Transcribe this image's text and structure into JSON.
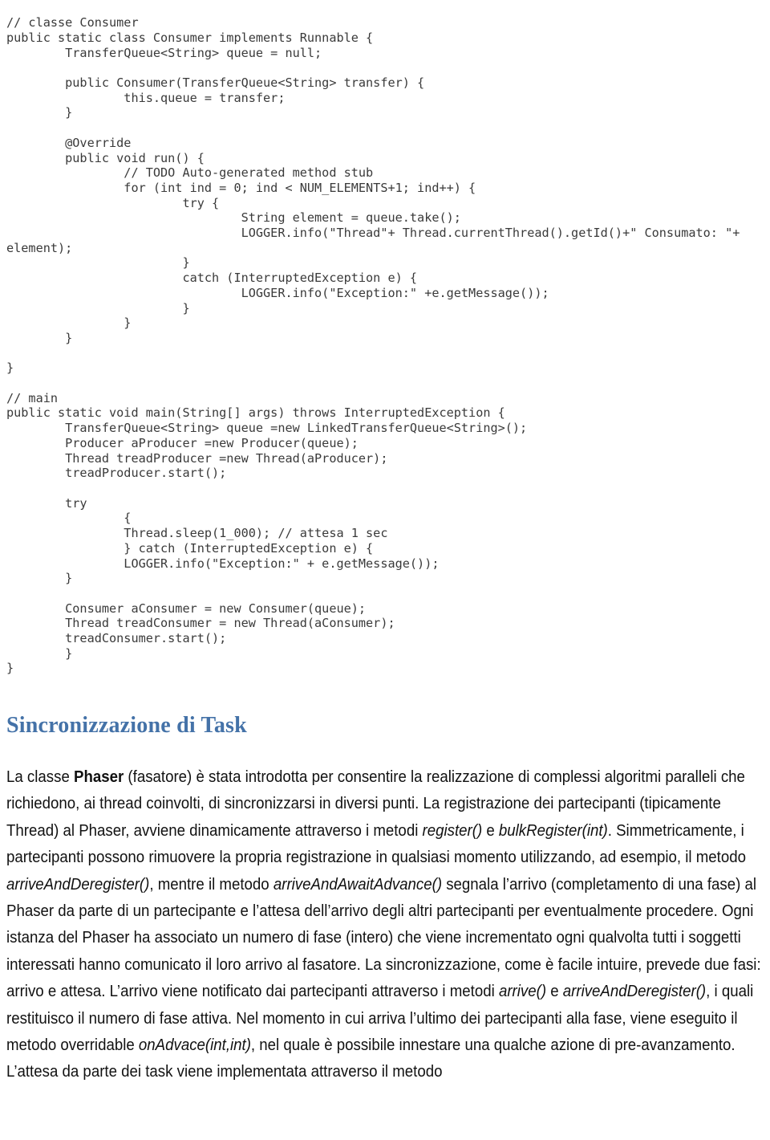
{
  "document": {
    "code_listing": {
      "language": "java",
      "lines": [
        "// classe Consumer",
        "public static class Consumer implements Runnable {",
        "        TransferQueue<String> queue = null;",
        "",
        "        public Consumer(TransferQueue<String> transfer) {",
        "                this.queue = transfer;",
        "        }",
        "",
        "        @Override",
        "        public void run() {",
        "                // TODO Auto-generated method stub",
        "                for (int ind = 0; ind < NUM_ELEMENTS+1; ind++) {",
        "                        try {",
        "                                String element = queue.take();",
        "                                LOGGER.info(\"Thread\"+ Thread.currentThread().getId()+\" Consumato: \"+",
        "element);",
        "                        }",
        "                        catch (InterruptedException e) {",
        "                                LOGGER.info(\"Exception:\" +e.getMessage());",
        "                        }",
        "                }",
        "        }",
        "",
        "}",
        "",
        "// main",
        "public static void main(String[] args) throws InterruptedException {",
        "        TransferQueue<String> queue =new LinkedTransferQueue<String>();",
        "        Producer aProducer =new Producer(queue);",
        "        Thread treadProducer =new Thread(aProducer);",
        "        treadProducer.start();",
        "",
        "        try",
        "                {",
        "                Thread.sleep(1_000); // attesa 1 sec",
        "                } catch (InterruptedException e) {",
        "                LOGGER.info(\"Exception:\" + e.getMessage());",
        "        }",
        "",
        "        Consumer aConsumer = new Consumer(queue);",
        "        Thread treadConsumer = new Thread(aConsumer);",
        "        treadConsumer.start();",
        "        }",
        "}"
      ]
    },
    "heading": {
      "text": "Sincronizzazione di Task",
      "color": "#4472a8"
    },
    "body": {
      "paragraph_html": "La classe <b>Phaser</b> (fasatore) è stata introdotta per consentire la realizzazione di complessi algoritmi paralleli che richiedono, ai thread coinvolti, di sincronizzarsi in diversi punti. La registrazione dei partecipanti (tipicamente Thread) al Phaser, avviene dinamicamente attraverso i metodi <i>register()</i> e <i>bulkRegister(int)</i>. Simmetricamente, i partecipanti possono rimuovere la propria registrazione in qualsiasi momento utilizzando, ad esempio, il metodo <i>arriveAndDeregister()</i>, mentre il metodo <i>arriveAndAwaitAdvance()</i> segnala l’arrivo (completamento di una fase) al Phaser da parte di un partecipante e l’attesa dell’arrivo degli altri partecipanti per eventualmente procedere. Ogni istanza del Phaser ha associato un numero di fase (intero) che viene incrementato ogni qualvolta tutti i soggetti interessati hanno comunicato il loro arrivo al fasatore. La sincronizzazione, come è facile intuire, prevede due fasi: arrivo e attesa. L’arrivo viene notificato dai partecipanti attraverso i metodi <i>arrive()</i> e <i>arriveAndDeregister()</i>, i quali restituisco il numero di fase attiva. Nel momento in cui arriva l’ultimo dei partecipanti alla fase, viene eseguito il metodo overridable <i>onAdvace(int,int)</i>, nel quale è possibile innestare una qualche azione di pre-avanzamento. L’attesa da parte dei task viene implementata attraverso il metodo"
    }
  }
}
